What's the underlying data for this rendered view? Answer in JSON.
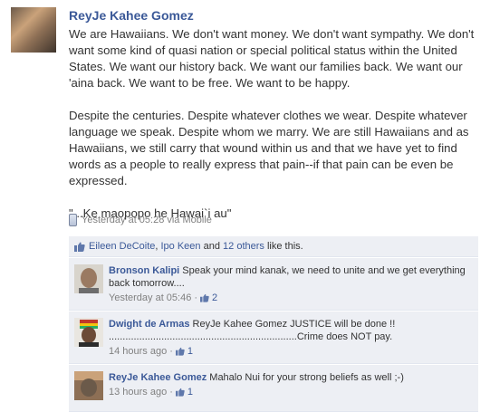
{
  "post": {
    "author": "ReyJe Kahee Gomez",
    "paragraphs": [
      "We are Hawaiians. We don't want money. We don't want sympathy. We don't want some kind of quasi nation or special political status within the United States. We want our history back. We want our families back. We want our 'aina back. We want to be free. We want to be happy.",
      "Despite the centuries. Despite whatever clothes we wear. Despite whatever language we speak. Despite whom we marry. We are still Hawaiians and as Hawaiians, we still carry that wound within us and that we have yet to find words as a people to really express that pain--if that pain can be even be expressed.",
      "\"...Ke maopopo he Hawai`i au\""
    ],
    "timestamp": "Yesterday at 05:28",
    "via": "via Mobile"
  },
  "likes": {
    "name1": "Eileen DeCoite",
    "sep": ",",
    "name2": "Ipo Keen",
    "and": "and",
    "others": "12 others",
    "suffix": "like this."
  },
  "comments": [
    {
      "name": "Bronson Kalipi",
      "text": "Speak your mind kanak, we need to unite and we get everything back tomorrow....",
      "time": "Yesterday at 05:46",
      "likes": "2"
    },
    {
      "name": "Dwight de Armas",
      "text": "ReyJe Kahee Gomez JUSTICE will be done !! ....................................................................Crime does NOT pay.",
      "time": "14 hours ago",
      "likes": "1"
    },
    {
      "name": "ReyJe Kahee Gomez",
      "text": "Mahalo Nui for your strong beliefs as well ;-)",
      "time": "13 hours ago",
      "likes": "1"
    }
  ],
  "dot": "·",
  "colors": {
    "link": "#3b5998",
    "ufi_bg": "#edeff4",
    "meta": "#808080"
  }
}
